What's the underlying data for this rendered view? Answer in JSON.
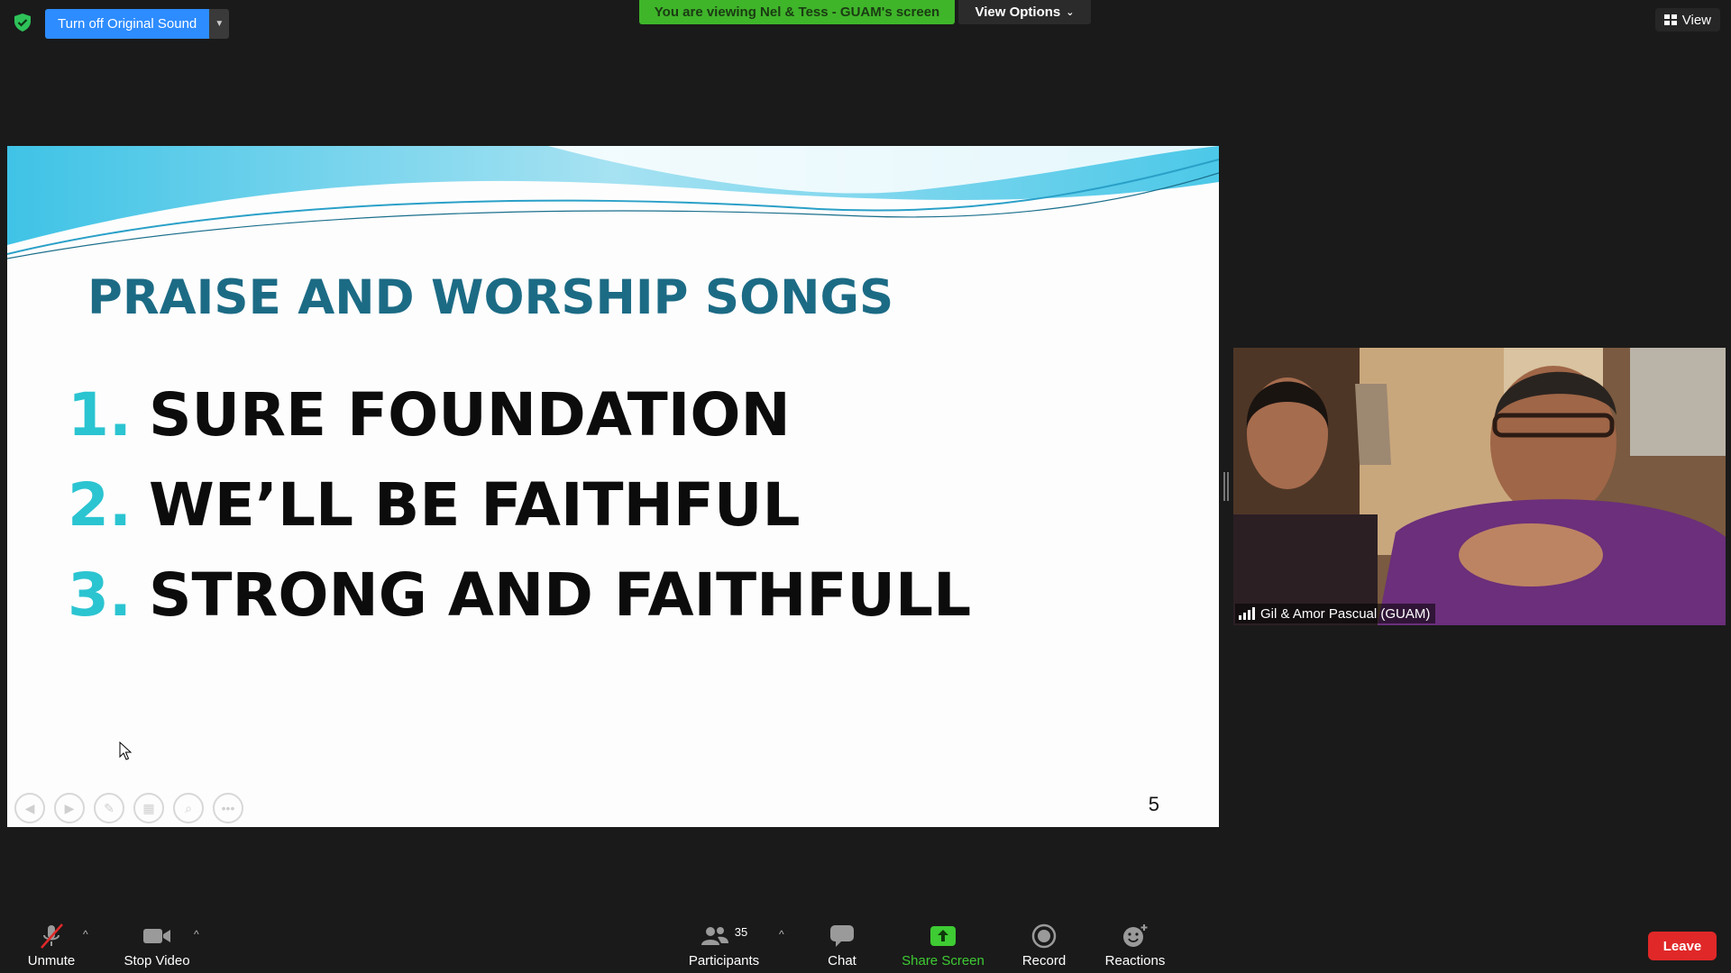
{
  "top_bar": {
    "original_sound_label": "Turn off Original Sound",
    "viewing_banner": "You are viewing Nel & Tess - GUAM's screen",
    "view_options_label": "View Options",
    "view_label": "View"
  },
  "slide": {
    "title": "PRAISE AND WORSHIP SONGS",
    "songs": [
      {
        "number": "1.",
        "title": "SURE FOUNDATION"
      },
      {
        "number": "2.",
        "title": "WE’LL BE FAITHFUL"
      },
      {
        "number": "3.",
        "title": "STRONG AND FAITHFULL"
      }
    ],
    "page_number": "5"
  },
  "video": {
    "participant_name": "Gil & Amor Pascual (GUAM)"
  },
  "toolbar": {
    "unmute_label": "Unmute",
    "stop_video_label": "Stop Video",
    "participants_label": "Participants",
    "participants_count": "35",
    "chat_label": "Chat",
    "share_screen_label": "Share Screen",
    "record_label": "Record",
    "reactions_label": "Reactions",
    "leave_label": "Leave"
  },
  "colors": {
    "accent_blue": "#2d8cff",
    "banner_green": "#3fb52a",
    "share_green": "#3ecb33",
    "leave_red": "#e02828",
    "slide_title": "#1c6b85",
    "slide_number": "#2bc4d1"
  },
  "icons": [
    "shield-icon",
    "chevron-down-icon",
    "view-grid-icon",
    "slide-prev-icon",
    "slide-next-icon",
    "pen-icon",
    "gallery-icon",
    "zoom-icon",
    "more-icon",
    "cursor-icon",
    "signal-icon",
    "microphone-muted-icon",
    "video-camera-icon",
    "participants-icon",
    "chat-icon",
    "share-screen-icon",
    "record-icon",
    "reactions-icon"
  ]
}
